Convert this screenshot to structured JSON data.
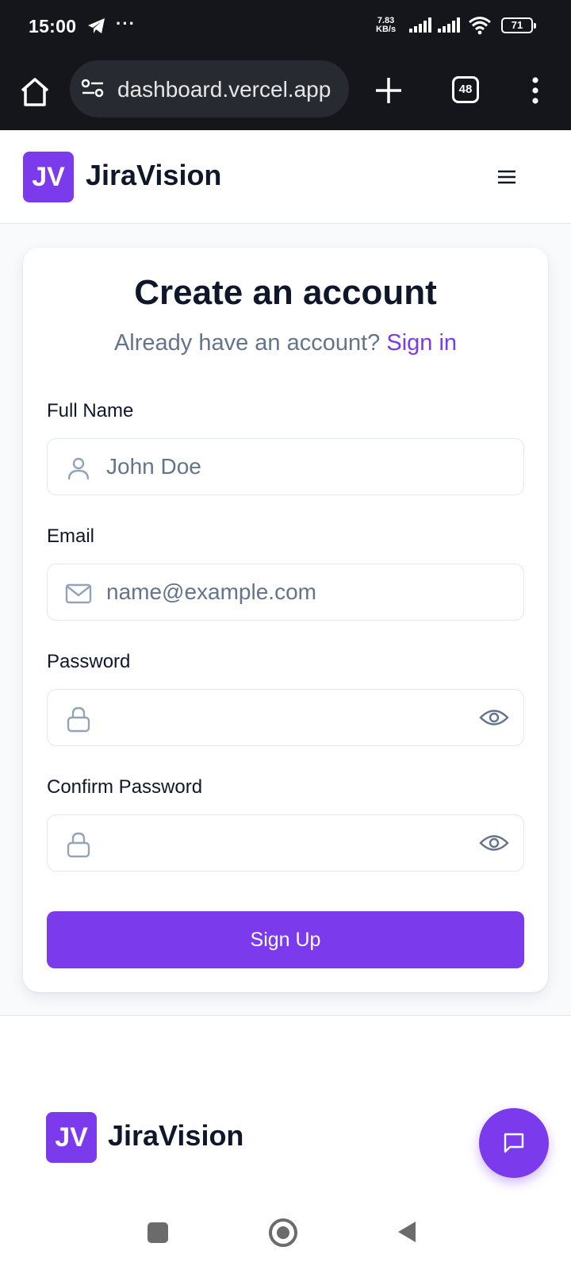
{
  "status_bar": {
    "time": "15:00",
    "more": "···",
    "net_speed_value": "7.83",
    "net_speed_unit": "KB/s",
    "battery": "71"
  },
  "browser": {
    "url": "dashboard.vercel.app",
    "tab_count": "48"
  },
  "header": {
    "logo": "JV",
    "brand": "JiraVision"
  },
  "form": {
    "title": "Create an account",
    "subtitle": "Already have an account?",
    "signin_link": "Sign in",
    "fields": [
      {
        "label": "Full Name",
        "placeholder": "John Doe",
        "value": ""
      },
      {
        "label": "Email",
        "placeholder": "name@example.com",
        "value": ""
      },
      {
        "label": "Password",
        "placeholder": "",
        "value": ""
      },
      {
        "label": "Confirm Password",
        "placeholder": "",
        "value": ""
      }
    ],
    "submit": "Sign Up"
  },
  "footer": {
    "logo": "JV",
    "brand": "JiraVision"
  },
  "icons": {
    "home": "home-icon",
    "site_settings": "tune-icon",
    "new_tab": "plus-icon",
    "menu": "more-vertical-icon",
    "hamburger": "hamburger-icon",
    "user": "user-icon",
    "mail": "mail-icon",
    "lock": "lock-icon",
    "eye": "eye-icon",
    "chat": "chat-icon"
  },
  "colors": {
    "accent": "#7c3aed",
    "text": "#0f172a",
    "muted": "#64748b",
    "border": "#e2e8f0",
    "chrome": "#14161b"
  }
}
